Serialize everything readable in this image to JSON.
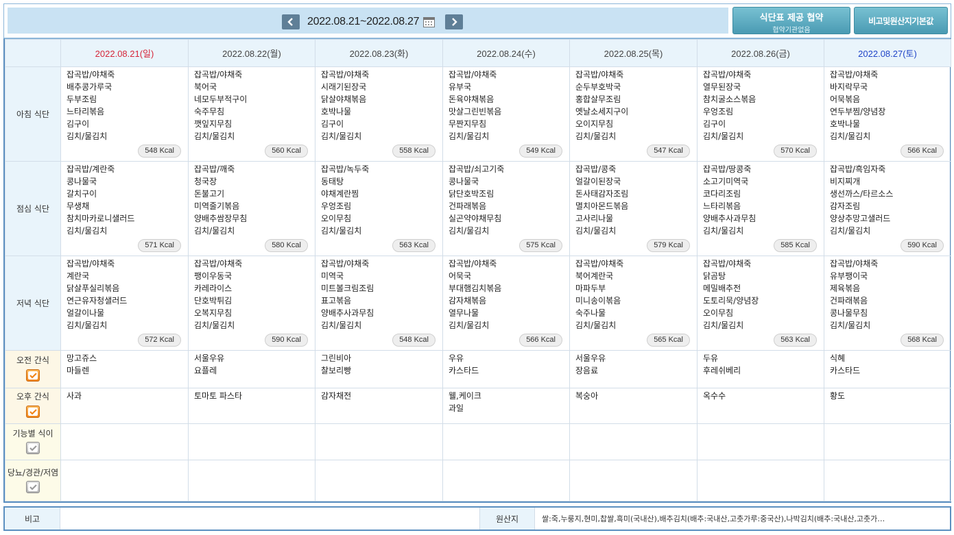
{
  "header": {
    "week": "2022.08.21~2022.08.27",
    "agree_button": "식단표 제공 협약",
    "agree_sub": "협약기관없음",
    "note_button": "비고및원산지기본값"
  },
  "days": [
    {
      "label": "2022.08.21(일)"
    },
    {
      "label": "2022.08.22(월)"
    },
    {
      "label": "2022.08.23(화)"
    },
    {
      "label": "2022.08.24(수)"
    },
    {
      "label": "2022.08.25(목)"
    },
    {
      "label": "2022.08.26(금)"
    },
    {
      "label": "2022.08.27(토)"
    }
  ],
  "rows": {
    "breakfast": "아침 식단",
    "lunch": "점심 식단",
    "dinner": "저녁 식단",
    "am_snack": "오전 간식",
    "pm_snack": "오후 간식",
    "functional": "기능별 식이",
    "diabetes": "당뇨/경관/저염"
  },
  "breakfast": [
    {
      "items": [
        "잡곡밥/야채죽",
        "배추콩가루국",
        "두부조림",
        "느타리볶음",
        "김구이",
        "김치/물김치"
      ],
      "kcal": "548 Kcal"
    },
    {
      "items": [
        "잡곡밥/야채죽",
        "북어국",
        "네모두부적구이",
        "숙주무침",
        "깻잎지무침",
        "김치/물김치"
      ],
      "kcal": "560 Kcal"
    },
    {
      "items": [
        "잡곡밥/야채죽",
        "시래기된장국",
        "닭살야채볶음",
        "호박나물",
        "김구이",
        "김치/물김치"
      ],
      "kcal": "558 Kcal"
    },
    {
      "items": [
        "잡곡밥/야채죽",
        "유부국",
        "돈육야채볶음",
        "맛살그린빈볶음",
        "무짠지무침",
        "김치/물김치"
      ],
      "kcal": "549 Kcal"
    },
    {
      "items": [
        "잡곡밥/야채죽",
        "순두부호박국",
        "홍합살무조림",
        "옛날소세지구이",
        "오이지무침",
        "김치/물김치"
      ],
      "kcal": "547 Kcal"
    },
    {
      "items": [
        "잡곡밥/야채죽",
        "열무된장국",
        "참치굴소스볶음",
        "우엉조림",
        "김구이",
        "김치/물김치"
      ],
      "kcal": "570 Kcal"
    },
    {
      "items": [
        "잡곡밥/야채죽",
        "바지락무국",
        "어묵볶음",
        "연두부찜/양념장",
        "호박나물",
        "김치/물김치"
      ],
      "kcal": "566 Kcal"
    }
  ],
  "lunch": [
    {
      "items": [
        "잡곡밥/계란죽",
        "콩나물국",
        "갈치구이",
        "무생채",
        "참치마카로니샐러드",
        "김치/물김치"
      ],
      "kcal": "571 Kcal"
    },
    {
      "items": [
        "잡곡밥/깨죽",
        "청국장",
        "돈불고기",
        "미역줄기볶음",
        "양배추쌈장무침",
        "김치/물김치"
      ],
      "kcal": "580 Kcal"
    },
    {
      "items": [
        "잡곡밥/녹두죽",
        "동태탕",
        "야채계란찜",
        "우엉조림",
        "오이무침",
        "김치/물김치"
      ],
      "kcal": "563 Kcal"
    },
    {
      "items": [
        "잡곡밥/쇠고기죽",
        "콩나물국",
        "닭단호박조림",
        "건파래볶음",
        "실곤약야채무침",
        "김치/물김치"
      ],
      "kcal": "575 Kcal"
    },
    {
      "items": [
        "잡곡밥/콩죽",
        "얼갈이된장국",
        "돈사태감자조림",
        "멸치아몬드볶음",
        "고사리나물",
        "김치/물김치"
      ],
      "kcal": "579 Kcal"
    },
    {
      "items": [
        "잡곡밥/땅콩죽",
        "소고기미역국",
        "코다리조림",
        "느타리볶음",
        "양배추사과무침",
        "김치/물김치"
      ],
      "kcal": "585 Kcal"
    },
    {
      "items": [
        "잡곡밥/흑임자죽",
        "비지찌개",
        "생선까스/타르소스",
        "감자조림",
        "양상추망고샐러드",
        "김치/물김치"
      ],
      "kcal": "590 Kcal"
    }
  ],
  "dinner": [
    {
      "items": [
        "잡곡밥/야채죽",
        "계란국",
        "닭살푸실리볶음",
        "연근유자청샐러드",
        "얼갈이나물",
        "김치/물김치"
      ],
      "kcal": "572 Kcal"
    },
    {
      "items": [
        "잡곡밥/야채죽",
        "팽이우동국",
        "카레라이스",
        "단호박튀김",
        "오복지무침",
        "김치/물김치"
      ],
      "kcal": "590 Kcal"
    },
    {
      "items": [
        "잡곡밥/야채죽",
        "미역국",
        "미트볼크림조림",
        "표고볶음",
        "양배추사과무침",
        "김치/물김치"
      ],
      "kcal": "548 Kcal"
    },
    {
      "items": [
        "잡곡밥/야채죽",
        "어묵국",
        "부대햄김치볶음",
        "감자채볶음",
        "열무나물",
        "김치/물김치"
      ],
      "kcal": "566 Kcal"
    },
    {
      "items": [
        "잡곡밥/야채죽",
        "북어계란국",
        "마파두부",
        "미니송이볶음",
        "숙주나물",
        "김치/물김치"
      ],
      "kcal": "565 Kcal"
    },
    {
      "items": [
        "잡곡밥/야채죽",
        "닭곰탕",
        "메밀배추전",
        "도토리묵/양념장",
        "오이무침",
        "김치/물김치"
      ],
      "kcal": "563 Kcal"
    },
    {
      "items": [
        "잡곡밥/야채죽",
        "유부팽이국",
        "제육볶음",
        "건파래볶음",
        "콩나물무침",
        "김치/물김치"
      ],
      "kcal": "568 Kcal"
    }
  ],
  "am_snack": [
    [
      "망고쥬스",
      "마들렌"
    ],
    [
      "서울우유",
      "요플레"
    ],
    [
      "그린비아",
      "찰보리빵"
    ],
    [
      "우유",
      "카스타드"
    ],
    [
      "서울우유",
      "장음료"
    ],
    [
      "두유",
      "후레쉬베리"
    ],
    [
      "식혜",
      "카스타드"
    ]
  ],
  "pm_snack": [
    [
      "사과"
    ],
    [
      "토마토 파스타"
    ],
    [
      "감자채전"
    ],
    [
      "웰,케이크",
      "과일"
    ],
    [
      "복숭아"
    ],
    [
      "옥수수"
    ],
    [
      "황도"
    ]
  ],
  "footer": {
    "note_label": "비고",
    "origin_label": "원산지",
    "origin_text": "쌀:죽,누룽지,현미,찹쌀,흑미(국내산),배추김치(배추:국내산,고춧가루:중국산),나박김치(배추:국내산,고춧가…"
  },
  "colors": {
    "sunday": "#d6263a",
    "saturday": "#2045c8",
    "accent": "#4a9bb3",
    "check_on": "#f1851a"
  }
}
